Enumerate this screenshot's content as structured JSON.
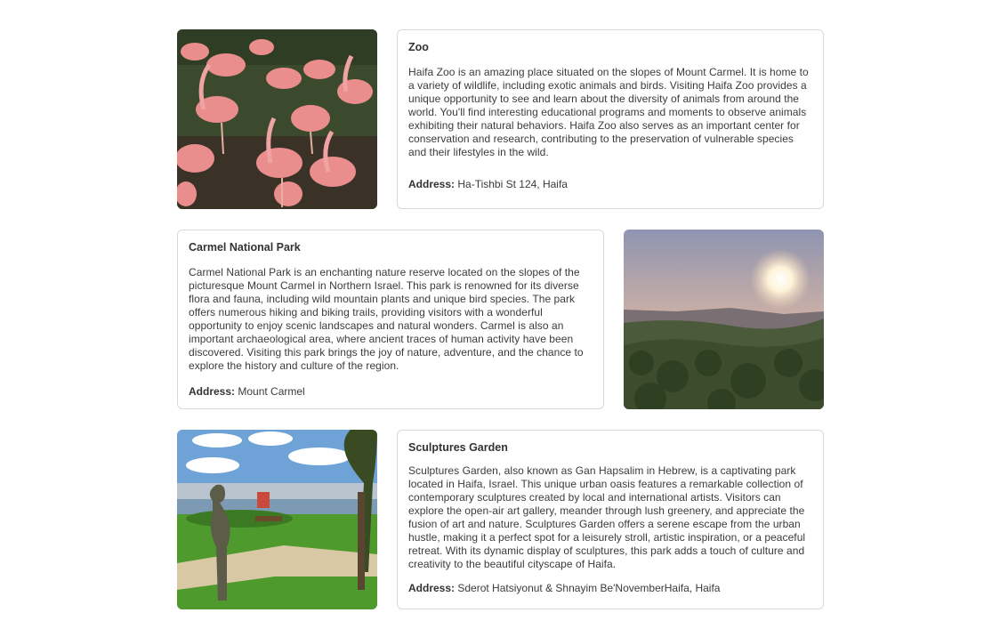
{
  "attractions": [
    {
      "title": "Zoo",
      "description": "Haifa Zoo is an amazing place situated on the slopes of Mount Carmel. It is home to a variety of wildlife, including exotic animals and birds. Visiting Haifa Zoo provides a unique opportunity to see and learn about the diversity of animals from around the world. You'll find interesting educational programs and moments to observe animals exhibiting their natural behaviors. Haifa Zoo also serves as an important center for conservation and research, contributing to the preservation of vulnerable species and their lifestyles in the wild.",
      "address_label": "Address:",
      "address": "Ha-Tishbi St 124, Haifa",
      "image": "flamingos-photo"
    },
    {
      "title": "Carmel National Park",
      "description": "Carmel National Park is an enchanting nature reserve located on the slopes of the picturesque Mount Carmel in Northern Israel. This park is renowned for its diverse flora and fauna, including wild mountain plants and unique bird species. The park offers numerous hiking and biking trails, providing visitors with a wonderful opportunity to enjoy scenic landscapes and natural wonders. Carmel is also an important archaeological area, where ancient traces of human activity have been discovered. Visiting this park brings the joy of nature, adventure, and the chance to explore the history and culture of the region.",
      "address_label": "Address:",
      "address": "Mount Carmel",
      "image": "forest-sunset-photo"
    },
    {
      "title": "Sculptures Garden",
      "description": "Sculptures Garden, also known as Gan Hapsalim in Hebrew, is a captivating park located in Haifa, Israel. This unique urban oasis features a remarkable collection of contemporary sculptures created by local and international artists. Visitors can explore the open-air art gallery, meander through lush greenery, and appreciate the fusion of art and nature. Sculptures Garden offers a serene escape from the urban hustle, making it a perfect spot for a leisurely stroll, artistic inspiration, or a peaceful retreat. With its dynamic display of sculptures, this park adds a touch of culture and creativity to the beautiful cityscape of Haifa.",
      "address_label": "Address:",
      "address": "Sderot Hatsiyonut & Shnayim Be'NovemberHaifa, Haifa",
      "image": "sculpture-garden-photo"
    }
  ]
}
